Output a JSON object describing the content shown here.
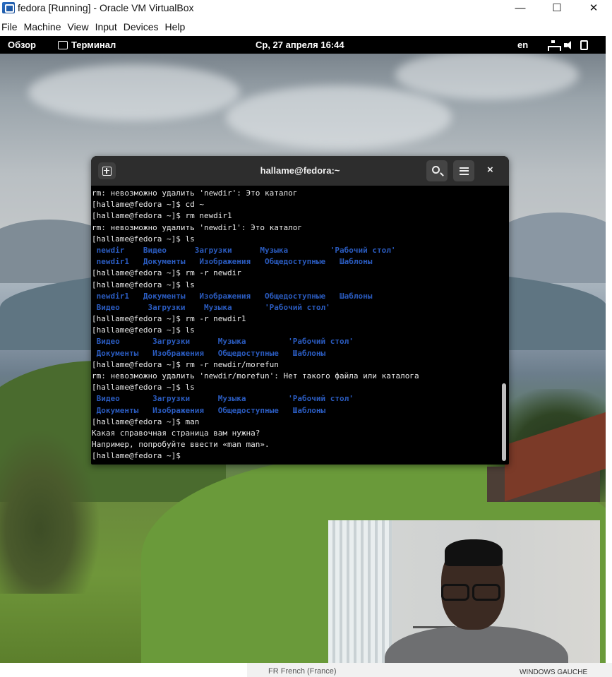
{
  "vbox": {
    "title": "fedora [Running] - Oracle VM VirtualBox",
    "menu": [
      "File",
      "Machine",
      "View",
      "Input",
      "Devices",
      "Help"
    ],
    "controls": {
      "minimize": "—",
      "maximize": "☐",
      "close": "✕"
    }
  },
  "gnome": {
    "activities": "Обзор",
    "app_name": "Терминал",
    "clock": "Ср, 27 апреля  16:44",
    "lang": "en",
    "tray_icons": [
      "network-icon",
      "volume-icon",
      "battery-icon"
    ]
  },
  "terminal": {
    "title": "hallame@fedora:~",
    "new_tab_icon": "new-tab-icon",
    "search_icon": "search-icon",
    "menu_icon": "hamburger-menu-icon",
    "close": "×",
    "lines": [
      {
        "text": "rm: невозможно удалить 'newdir': Это каталог",
        "kind": "out"
      },
      {
        "text": "[hallame@fedora ~]$ cd ~",
        "kind": "out"
      },
      {
        "text": "[hallame@fedora ~]$ rm newdir1",
        "kind": "out"
      },
      {
        "text": "rm: невозможно удалить 'newdir1': Это каталог",
        "kind": "out"
      },
      {
        "text": "[hallame@fedora ~]$ ls",
        "kind": "out"
      },
      {
        "text": " newdir    Видео      Загрузки      Музыка         'Рабочий стол'",
        "kind": "ls"
      },
      {
        "text": " newdir1   Документы   Изображения   Общедоступные   Шаблоны",
        "kind": "ls"
      },
      {
        "text": "[hallame@fedora ~]$ rm -r newdir",
        "kind": "out"
      },
      {
        "text": "[hallame@fedora ~]$ ls",
        "kind": "out"
      },
      {
        "text": " newdir1   Документы   Изображения   Общедоступные   Шаблоны",
        "kind": "ls"
      },
      {
        "text": " Видео      Загрузки    Музыка       'Рабочий стол'",
        "kind": "ls"
      },
      {
        "text": "[hallame@fedora ~]$ rm -r newdir1",
        "kind": "out"
      },
      {
        "text": "[hallame@fedora ~]$ ls",
        "kind": "out"
      },
      {
        "text": " Видео       Загрузки      Музыка         'Рабочий стол'",
        "kind": "ls"
      },
      {
        "text": " Документы   Изображения   Общедоступные   Шаблоны",
        "kind": "ls"
      },
      {
        "text": "[hallame@fedora ~]$ rm -r newdir/morefun",
        "kind": "out"
      },
      {
        "text": "rm: невозможно удалить 'newdir/morefun': Нет такого файла или каталога",
        "kind": "out"
      },
      {
        "text": "[hallame@fedora ~]$ ls",
        "kind": "out"
      },
      {
        "text": " Видео       Загрузки      Музыка         'Рабочий стол'",
        "kind": "ls"
      },
      {
        "text": " Документы   Изображения   Общедоступные   Шаблоны",
        "kind": "ls"
      },
      {
        "text": "[hallame@fedora ~]$ man",
        "kind": "out"
      },
      {
        "text": "Какая справочная страница вам нужна?",
        "kind": "out"
      },
      {
        "text": "Например, попробуйте ввести «man man».",
        "kind": "out"
      },
      {
        "text": "[hallame@fedora ~]$ ",
        "kind": "out"
      }
    ],
    "colors": {
      "background": "#000000",
      "text": "#e8e8e8",
      "directory": "#2a5bbf",
      "header": "#2d2d2d"
    }
  },
  "host": {
    "language_indicator": "FR French (France)",
    "keyboard_layout": "WINDOWS GAUCHE"
  },
  "webcam": {
    "label": "webcam-overlay"
  }
}
